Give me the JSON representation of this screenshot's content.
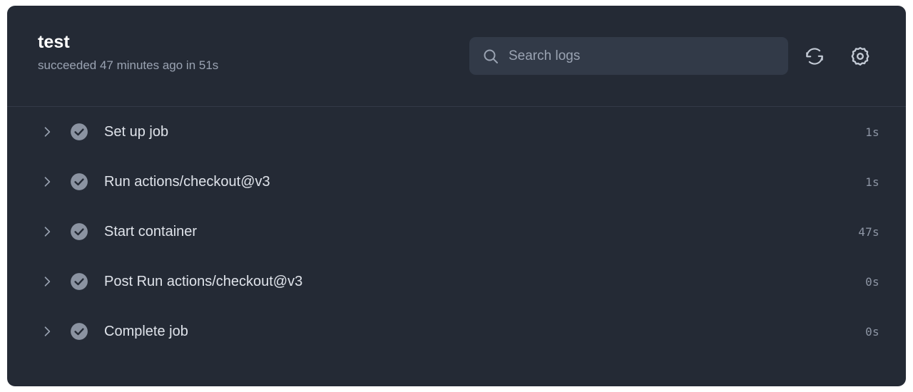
{
  "theme": {
    "page_background": "#ffffff",
    "panel_background": "#242a35",
    "search_background": "#323a48",
    "divider": "#333a47",
    "title_color": "#ffffff",
    "muted_text": "#9aa3b2",
    "label_text": "#dfe3ea",
    "status_icon_color": "#8b93a1",
    "duration_text": "#8d95a4"
  },
  "header": {
    "title": "test",
    "status_line": "succeeded 47 minutes ago in 51s",
    "search": {
      "placeholder": "Search logs",
      "value": "",
      "icon": "search-icon"
    },
    "actions": [
      {
        "name": "refresh-button",
        "icon": "refresh-icon",
        "label": ""
      },
      {
        "name": "settings-button",
        "icon": "gear-icon",
        "label": ""
      }
    ]
  },
  "steps": [
    {
      "label": "Set up job",
      "duration": "1s",
      "status": "success",
      "expanded": false
    },
    {
      "label": "Run actions/checkout@v3",
      "duration": "1s",
      "status": "success",
      "expanded": false
    },
    {
      "label": "Start container",
      "duration": "47s",
      "status": "success",
      "expanded": false
    },
    {
      "label": "Post Run actions/checkout@v3",
      "duration": "0s",
      "status": "success",
      "expanded": false
    },
    {
      "label": "Complete job",
      "duration": "0s",
      "status": "success",
      "expanded": false
    }
  ]
}
